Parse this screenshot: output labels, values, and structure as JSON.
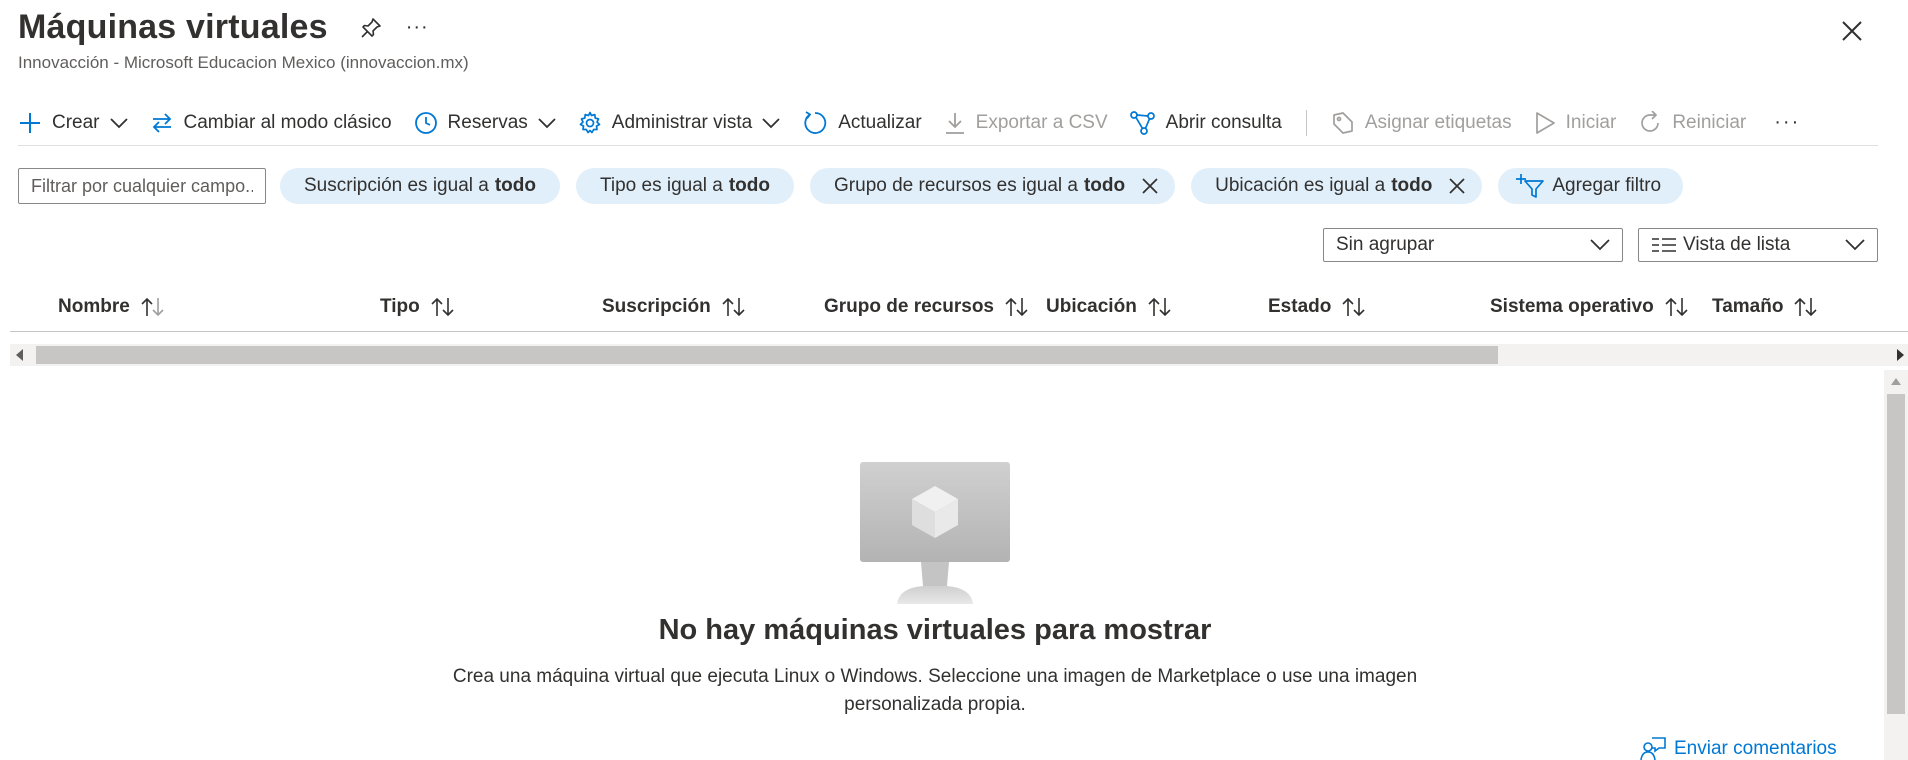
{
  "header": {
    "title": "Máquinas virtuales",
    "subtitle": "Innovacción - Microsoft Educacion Mexico (innovaccion.mx)",
    "more_label": "···"
  },
  "toolbar": {
    "create": "Crear",
    "switch_classic": "Cambiar al modo clásico",
    "reservations": "Reservas",
    "manage_view": "Administrar vista",
    "refresh": "Actualizar",
    "export_csv": "Exportar a CSV",
    "open_query": "Abrir consulta",
    "assign_tags": "Asignar etiquetas",
    "start": "Iniciar",
    "restart": "Reiniciar",
    "more": "···"
  },
  "filters": {
    "placeholder": "Filtrar por cualquier campo...",
    "pills": [
      {
        "prefix": "Suscripción es igual a",
        "value": "todo"
      },
      {
        "prefix": "Tipo es igual a",
        "value": "todo"
      },
      {
        "prefix": "Grupo de recursos es igual a",
        "value": "todo"
      },
      {
        "prefix": "Ubicación es igual a",
        "value": "todo"
      }
    ],
    "add_filter": "Agregar filtro"
  },
  "grouping": {
    "group_value": "Sin agrupar",
    "view_value": "Vista de lista"
  },
  "table": {
    "columns": [
      "Nombre",
      "Tipo",
      "Suscripción",
      "Grupo de recursos",
      "Ubicación",
      "Estado",
      "Sistema operativo",
      "Tamaño"
    ]
  },
  "empty_state": {
    "title": "No hay máquinas virtuales para mostrar",
    "description_line1": "Crea una máquina virtual que ejecuta Linux o Windows. Seleccione una imagen de Marketplace o use una imagen",
    "description_line2": "personalizada propia."
  },
  "feedback": {
    "label": "Enviar comentarios"
  },
  "colors": {
    "accent": "#0078d4",
    "pill_bg": "#e1effa",
    "disabled": "#a19f9d"
  }
}
